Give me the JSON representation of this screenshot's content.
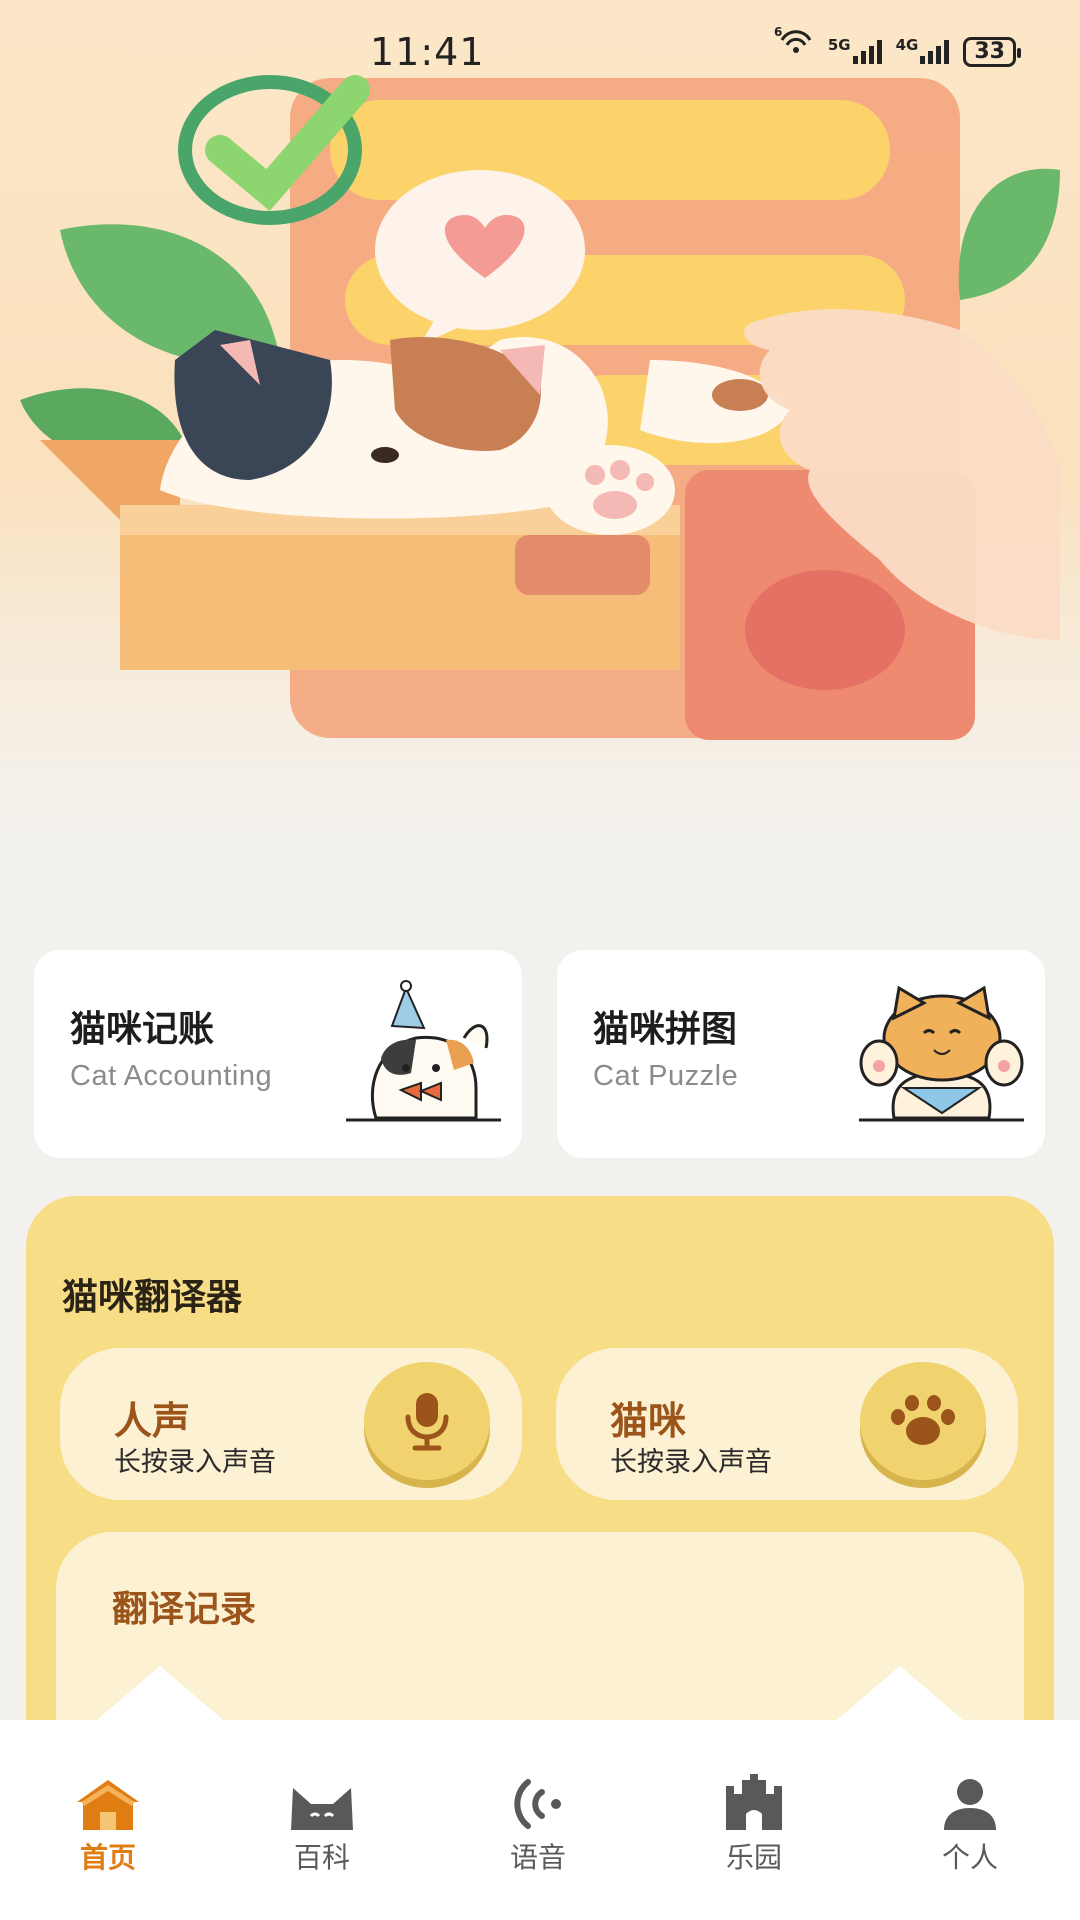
{
  "status_bar": {
    "time": "11:41",
    "wifi_label": "6",
    "net1": "5G",
    "net2": "4G",
    "battery": "33"
  },
  "features": [
    {
      "title": "猫咪记账",
      "subtitle": "Cat Accounting",
      "icon": "cat-party-icon"
    },
    {
      "title": "猫咪拼图",
      "subtitle": "Cat Puzzle",
      "icon": "cat-wave-icon"
    }
  ],
  "translator": {
    "title": "猫咪翻译器",
    "human": {
      "label": "人声",
      "hint": "长按录入声音",
      "icon": "microphone-icon"
    },
    "cat": {
      "label": "猫咪",
      "hint": "长按录入声音",
      "icon": "paw-icon"
    },
    "history_title": "翻译记录"
  },
  "tabs": [
    {
      "label": "首页",
      "icon": "home-icon",
      "active": true
    },
    {
      "label": "百科",
      "icon": "cat-ears-icon",
      "active": false
    },
    {
      "label": "语音",
      "icon": "voice-wave-icon",
      "active": false
    },
    {
      "label": "乐园",
      "icon": "castle-icon",
      "active": false
    },
    {
      "label": "个人",
      "icon": "person-icon",
      "active": false
    }
  ],
  "colors": {
    "accent": "#e07d12",
    "panel_yellow": "#f6dd86",
    "panel_cream": "#fcf1d2",
    "label_brown": "#9b5419"
  }
}
